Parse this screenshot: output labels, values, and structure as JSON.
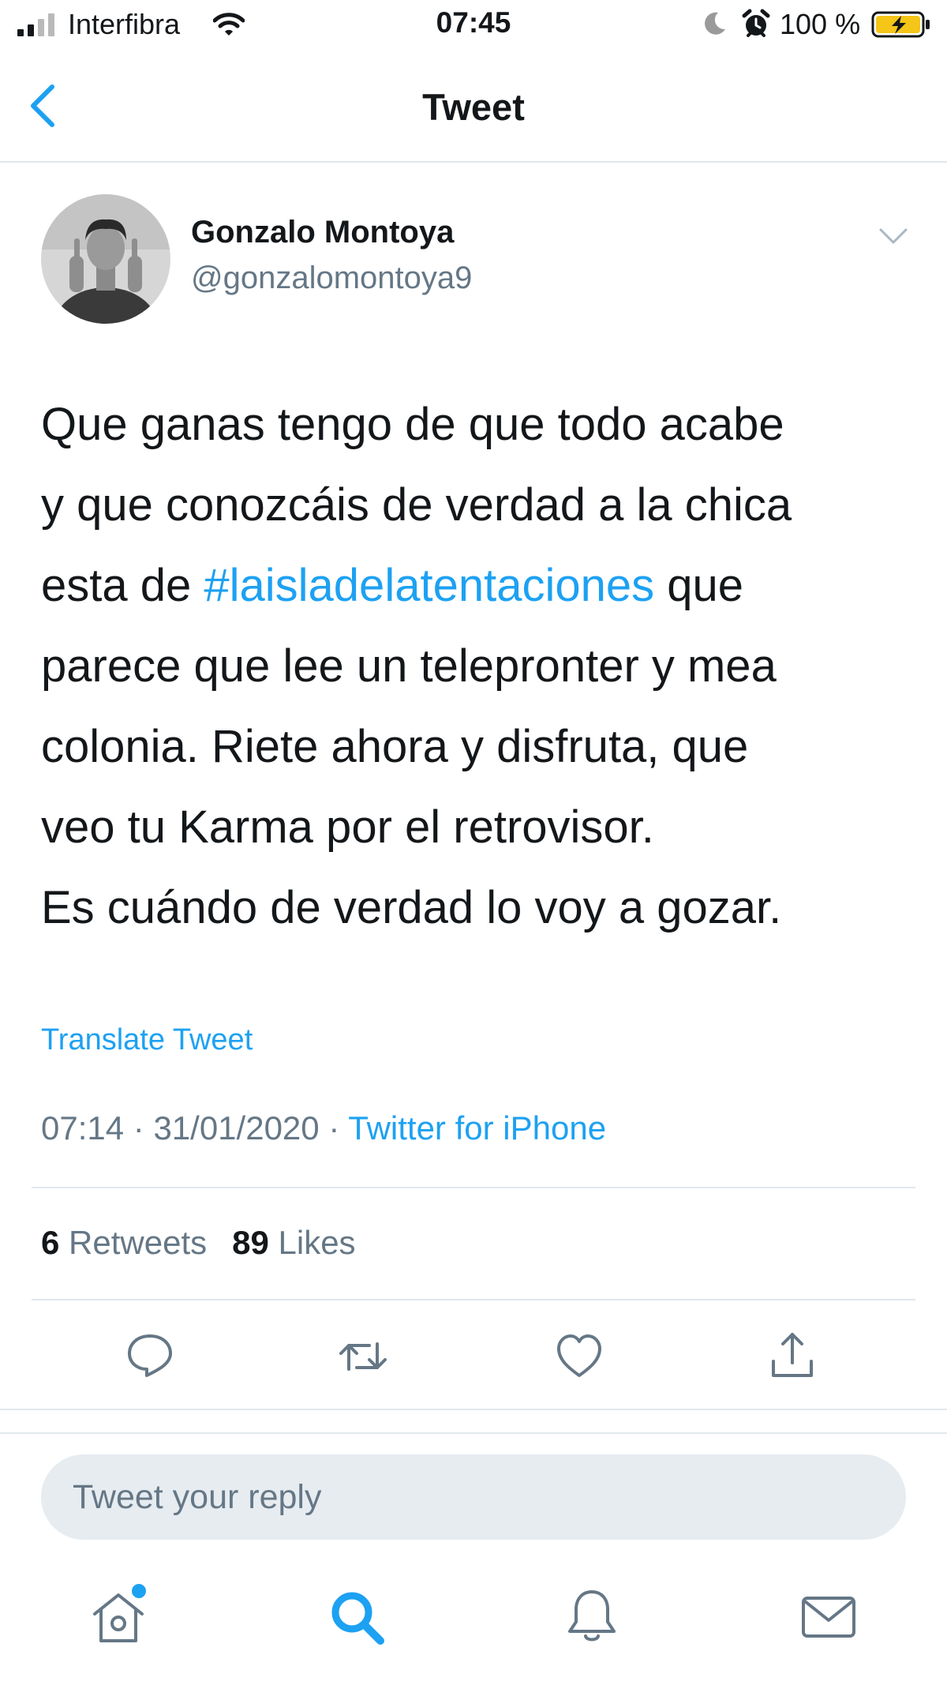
{
  "status_bar": {
    "carrier": "Interfibra",
    "time": "07:45",
    "battery_percent": "100 %"
  },
  "nav": {
    "title": "Tweet"
  },
  "tweet": {
    "author_name": "Gonzalo Montoya",
    "author_handle": "@gonzalomontoya9",
    "lines": [
      "Que ganas tengo de que todo acabe",
      "y que conozcáis de verdad a la chica",
      "esta de ",
      "parece que lee un telepronter y mea",
      "colonia. Riete ahora y disfruta, que",
      "veo tu Karma por el retrovisor.",
      "Es cuándo de verdad lo voy a gozar."
    ],
    "hashtag": "#laisladelatentaciones",
    "hashtag_suffix": " que",
    "translate_label": "Translate Tweet",
    "time": "07:14",
    "date": "31/01/2020",
    "separator": " · ",
    "source": "Twitter for iPhone",
    "retweets_count": "6",
    "retweets_label": "Retweets",
    "likes_count": "89",
    "likes_label": "Likes"
  },
  "reply": {
    "placeholder": "Tweet your reply"
  },
  "colors": {
    "accent": "#1da1f2",
    "text": "#14171a",
    "secondary_text": "#657786",
    "divider": "#e1e8ed",
    "reply_box_bg": "#e6ecf0",
    "battery_charging": "#f5c518"
  },
  "icons": {
    "back": "chevron-left-icon",
    "caret": "chevron-down-icon",
    "reply": "speech-bubble-icon",
    "retweet": "retweet-icon",
    "like": "heart-icon",
    "share": "share-icon",
    "home": "home-icon",
    "search": "search-icon",
    "notifications": "bell-icon",
    "messages": "envelope-icon"
  }
}
